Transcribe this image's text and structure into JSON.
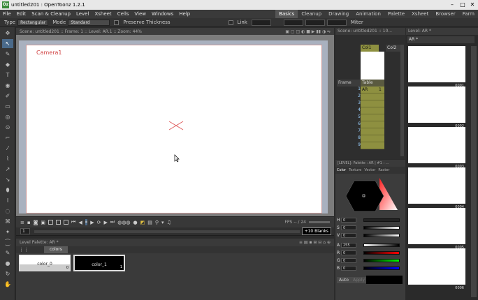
{
  "window": {
    "title": "untitled201 : OpenToonz 1.2.1",
    "app_icon": "toonz-logo"
  },
  "menubar": {
    "items": [
      "File",
      "Edit",
      "Scan & Cleanup",
      "Level",
      "Xsheet",
      "Cells",
      "View",
      "Windows",
      "Help"
    ]
  },
  "rooms": {
    "items": [
      "Basics",
      "Cleanup",
      "Drawing",
      "Animation",
      "Palette",
      "Xsheet",
      "Browser",
      "Farm"
    ],
    "active": "Basics"
  },
  "tool_options": {
    "type_label": "Type",
    "type_value": "Rectangular",
    "mode_label": "Mode",
    "mode_value": "Standard",
    "preserve_thickness": "Preserve Thickness",
    "link": "Link",
    "miter": "Miter"
  },
  "viewer": {
    "header": "Scene: untitled201  ::  Frame: 1  ::  Level: AR.1  ::  Zoom: 44%",
    "camera_label": "Camera1",
    "fps": "FPS -- / 24"
  },
  "frame_row": {
    "frame": "1",
    "blanks": "+10 Blanks"
  },
  "level_palette": {
    "header": "Level Palette: AR *",
    "tab": "colors",
    "styles": [
      {
        "name": "color_0",
        "id": "0"
      },
      {
        "name": "color_1",
        "id": "1"
      }
    ]
  },
  "xsheet": {
    "header": "Scene: untitled201 :: 10...",
    "col1": "Col1",
    "col2": "Col2",
    "frame_label": "Frame",
    "table_label": "Table",
    "rows": [
      {
        "n": "1",
        "cell": "AR",
        "v": "1"
      },
      {
        "n": "2",
        "cell": "",
        "v": ""
      },
      {
        "n": "3",
        "cell": "",
        "v": ""
      },
      {
        "n": "4",
        "cell": "",
        "v": ""
      },
      {
        "n": "5",
        "cell": "",
        "v": ""
      },
      {
        "n": "6",
        "cell": "",
        "v": ""
      },
      {
        "n": "7",
        "cell": "",
        "v": ""
      },
      {
        "n": "8",
        "cell": "",
        "v": ""
      },
      {
        "n": "9",
        "cell": "",
        "v": ""
      }
    ]
  },
  "style_editor": {
    "header": "[LEVEL]: Palette : AR | #1 : ...",
    "tabs": [
      "Color",
      "Texture",
      "Vector",
      "Raster"
    ],
    "channels": [
      {
        "k": "H",
        "v": "0"
      },
      {
        "k": "S",
        "v": "0"
      },
      {
        "k": "V",
        "v": "0"
      },
      {
        "k": "A",
        "v": "255"
      },
      {
        "k": "R",
        "v": "0"
      },
      {
        "k": "G",
        "v": "0"
      },
      {
        "k": "B",
        "v": "0"
      }
    ],
    "auto": "Auto",
    "apply": "Apply"
  },
  "level_strip": {
    "header": "Level: AR *",
    "level_name": "AR *",
    "frames": [
      "0001",
      "0002",
      "0003",
      "0004",
      "0005",
      "0006"
    ]
  },
  "colors": {
    "accent": "#4a6a8a",
    "cell": "#8e9040",
    "camera": "#d04040"
  }
}
